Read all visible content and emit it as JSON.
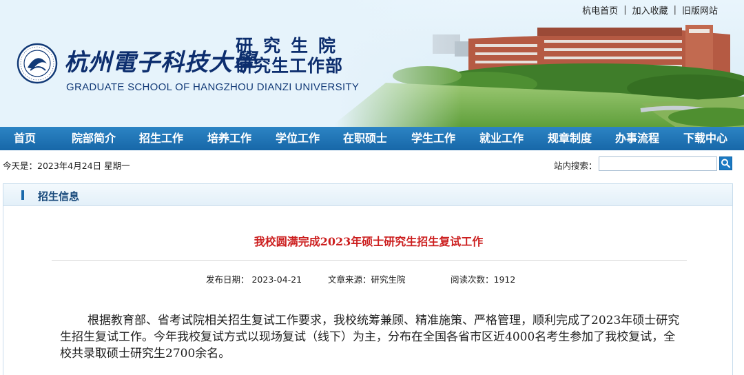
{
  "top_links": [
    "杭电首页",
    "加入收藏",
    "旧版网站"
  ],
  "header": {
    "university_cn": "杭州電子科技大學",
    "school_cn_line1": "研究生院",
    "school_cn_line2": "研究生工作部",
    "school_en": "GRADUATE SCHOOL OF HANGZHOU DIANZI UNIVERSITY"
  },
  "nav": [
    "首页",
    "院部简介",
    "招生工作",
    "培养工作",
    "学位工作",
    "在职硕士",
    "学生工作",
    "就业工作",
    "规章制度",
    "办事流程",
    "下载中心"
  ],
  "infobar": {
    "date": "今天是：2023年4月24日 星期一",
    "search_label": "站内搜索：",
    "search_value": ""
  },
  "panel": {
    "section_title": "招生信息",
    "article_title": "我校圆满完成2023年硕士研究生招生复试工作",
    "publish_date": "发布日期： 2023-04-21",
    "source": "文章来源：研究生院",
    "reads": "阅读次数：1912",
    "body": "根据教育部、省考试院相关招生复试工作要求，我校统筹兼顾、精准施策、严格管理，顺利完成了2023年硕士研究生招生复试工作。今年我校复试方式以现场复试（线下）为主，分布在全国各省市区近4000名考生参加了我校复试，全校共录取硕士研究生2700余名。"
  },
  "colors": {
    "nav_blue": "#1b74b8",
    "title_red": "#cc1f1f",
    "brand_navy": "#0d2e6e"
  },
  "icons": [
    "university-seal-icon",
    "search-icon"
  ]
}
